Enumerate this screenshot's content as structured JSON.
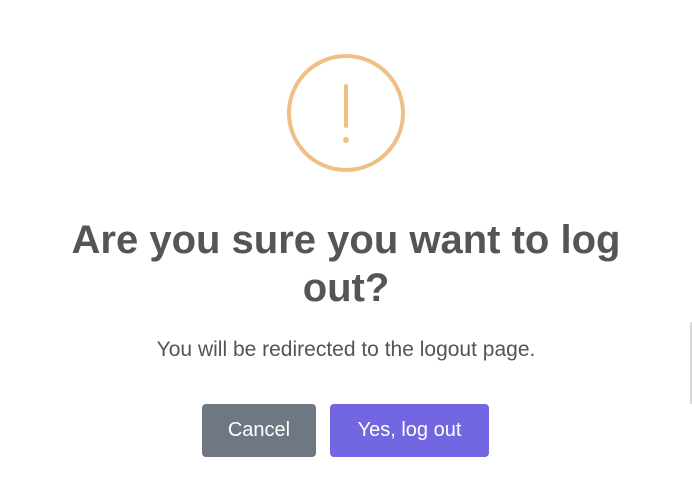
{
  "dialog": {
    "icon": "warning-exclamation-icon",
    "icon_color": "#f0bf86",
    "title": "Are you sure you want to log out?",
    "message": "You will be redirected to the logout page.",
    "cancel_label": "Cancel",
    "confirm_label": "Yes, log out",
    "cancel_color": "#6f7782",
    "confirm_color": "#7367e1"
  }
}
